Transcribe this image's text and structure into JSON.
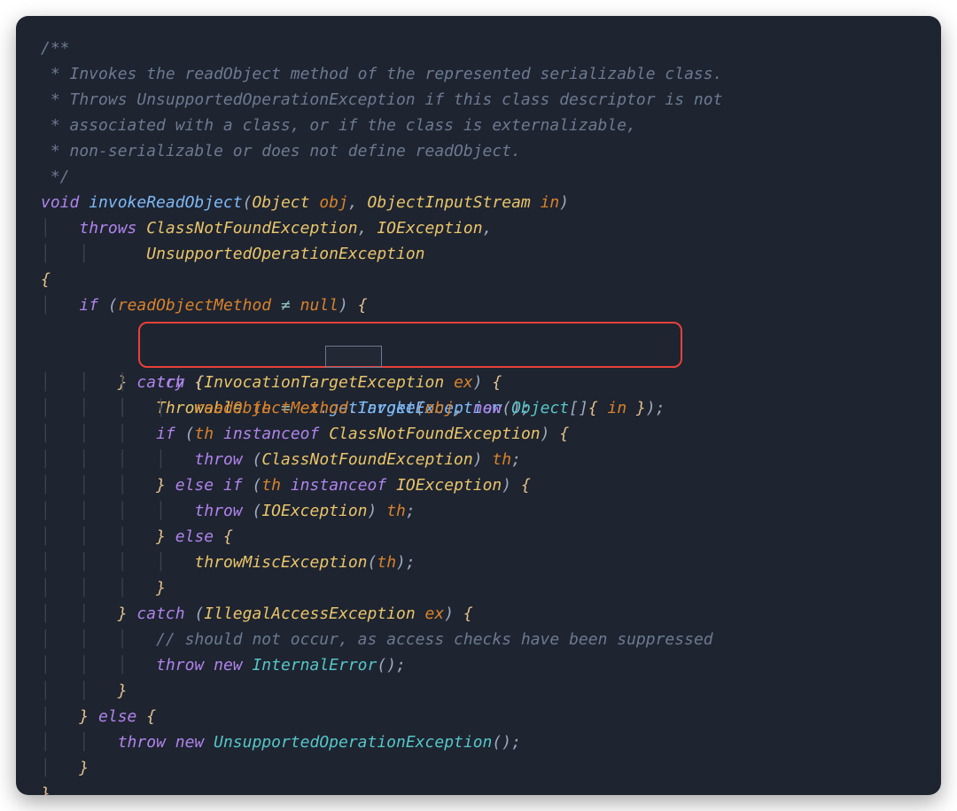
{
  "colors": {
    "background": "#1e2430",
    "comment": "#6c7a90",
    "keyword": "#b084eb",
    "function": "#7ebaf7",
    "type": "#e9c46a",
    "variable": "#d9822b",
    "punctuation": "#a0aabe",
    "cyan": "#56c6c9",
    "highlight_border": "#e8413a"
  },
  "comment": {
    "l1": "/**",
    "l2": " * Invokes the readObject method of the represented serializable class.",
    "l3": " * Throws UnsupportedOperationException if this class descriptor is not",
    "l4": " * associated with a class, or if the class is externalizable,",
    "l5": " * non-serializable or does not define readObject.",
    "l6": " */"
  },
  "kw": {
    "void": "void",
    "throws": "throws",
    "if": "if",
    "try": "try",
    "catch": "catch",
    "throw": "throw",
    "new": "new",
    "instanceof": "instanceof",
    "else": "else",
    "else_if": "else if",
    "null": "null"
  },
  "ident": {
    "invokeReadObject": "invokeReadObject",
    "Object": "Object",
    "obj": "obj",
    "ObjectInputStream": "ObjectInputStream",
    "in": "in",
    "ClassNotFoundException": "ClassNotFoundException",
    "IOException": "IOException",
    "UnsupportedOperationException": "UnsupportedOperationException",
    "readObjectMethod": "readObjectMethod",
    "invoke": "invoke",
    "InvocationTargetException": "InvocationTargetException",
    "ex": "ex",
    "Throwable": "Throwable",
    "th": "th",
    "getTargetException": "getTargetException",
    "IllegalAccessException": "IllegalAccessException",
    "throwMiscException": "throwMiscException",
    "InternalError": "InternalError"
  },
  "misc": {
    "neq": "≠",
    "line_comment": "// should not occur, as access checks have been suppressed",
    "guide": "│",
    "open_brace": "{",
    "close_brace": "}",
    "open_paren": "(",
    "close_paren": ")",
    "open_sq": "[",
    "close_sq": "]",
    "comma": ",",
    "dot": ".",
    "semi": ";",
    "space": " ",
    "eq": "="
  }
}
